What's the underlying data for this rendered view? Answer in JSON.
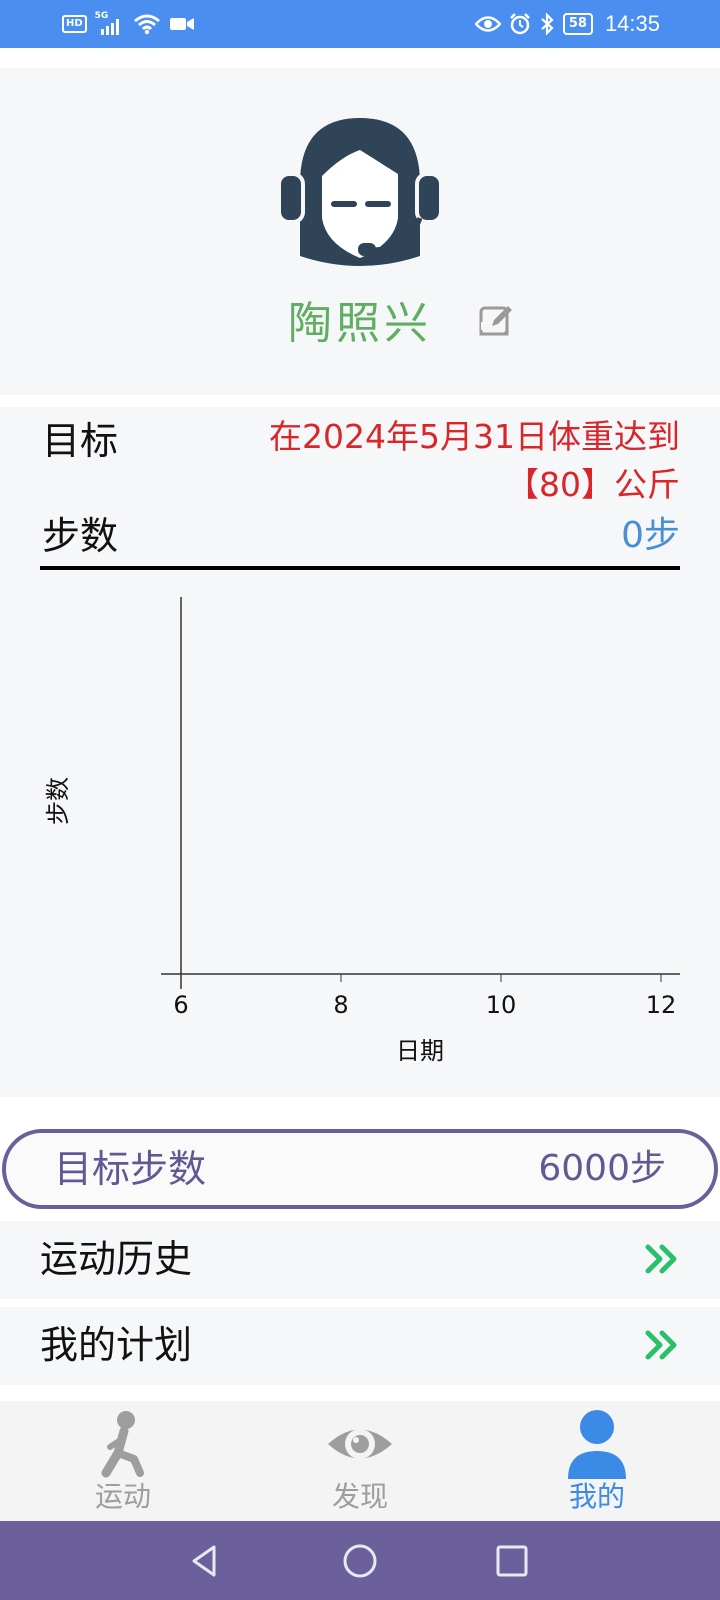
{
  "status_bar": {
    "network_hd": "HD",
    "network_gen": "5G",
    "battery": "58",
    "time": "14:35",
    "icons_left": [
      "hd-icon",
      "signal-5g-icon",
      "wifi-icon",
      "video-icon"
    ],
    "icons_right": [
      "eye-icon",
      "alarm-icon",
      "bluetooth-icon",
      "battery-icon"
    ]
  },
  "profile": {
    "name": "陶照兴",
    "avatar_icon": "headset-avatar-icon",
    "edit_icon": "edit-icon"
  },
  "goal": {
    "label": "目标",
    "line1": "在2024年5月31日体重达到",
    "line2": "【80】公斤"
  },
  "steps": {
    "label": "步数",
    "value": "0步"
  },
  "chart_data": {
    "type": "line",
    "xlabel": "日期",
    "ylabel": "步数",
    "x_ticks": [
      "6",
      "8",
      "10",
      "12"
    ],
    "xlim": [
      6,
      12
    ],
    "series": [],
    "grid": false
  },
  "target_steps": {
    "label": "目标步数",
    "value": "6000步"
  },
  "menu": [
    {
      "label": "运动历史",
      "icon": "double-chevron-right-icon"
    },
    {
      "label": "我的计划",
      "icon": "double-chevron-right-icon"
    }
  ],
  "bottom_nav": {
    "items": [
      {
        "label": "运动",
        "icon": "running-person-icon",
        "active": false
      },
      {
        "label": "发现",
        "icon": "eye-icon",
        "active": false
      },
      {
        "label": "我的",
        "icon": "person-icon",
        "active": true
      }
    ]
  },
  "system_nav": {
    "icons": [
      "back-icon",
      "home-icon",
      "recent-apps-icon"
    ]
  },
  "colors": {
    "status_bar": "#4a8ff0",
    "name_green": "#5fae62",
    "goal_red": "#d9262b",
    "steps_blue": "#4a8fd6",
    "pill_purple": "#6a5f99",
    "arrow_green": "#2bbf6a",
    "nav_active": "#3b8ae6",
    "nav_inactive": "#9e9e9e",
    "system_nav": "#6b609b",
    "panel_bg": "#f6f7f9"
  }
}
